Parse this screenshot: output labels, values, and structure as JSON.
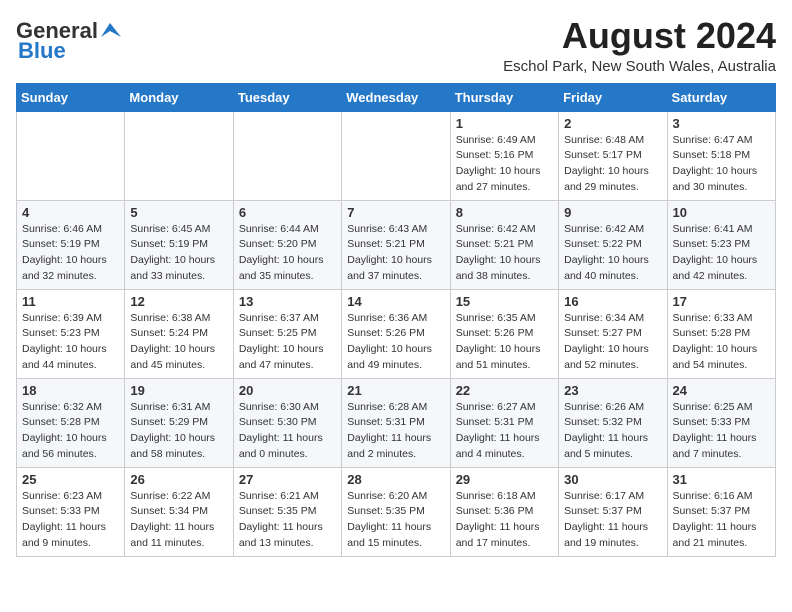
{
  "logo": {
    "general": "General",
    "blue": "Blue"
  },
  "header": {
    "month_year": "August 2024",
    "location": "Eschol Park, New South Wales, Australia"
  },
  "days_of_week": [
    "Sunday",
    "Monday",
    "Tuesday",
    "Wednesday",
    "Thursday",
    "Friday",
    "Saturday"
  ],
  "weeks": [
    [
      {
        "day": "",
        "info": ""
      },
      {
        "day": "",
        "info": ""
      },
      {
        "day": "",
        "info": ""
      },
      {
        "day": "",
        "info": ""
      },
      {
        "day": "1",
        "info": "Sunrise: 6:49 AM\nSunset: 5:16 PM\nDaylight: 10 hours\nand 27 minutes."
      },
      {
        "day": "2",
        "info": "Sunrise: 6:48 AM\nSunset: 5:17 PM\nDaylight: 10 hours\nand 29 minutes."
      },
      {
        "day": "3",
        "info": "Sunrise: 6:47 AM\nSunset: 5:18 PM\nDaylight: 10 hours\nand 30 minutes."
      }
    ],
    [
      {
        "day": "4",
        "info": "Sunrise: 6:46 AM\nSunset: 5:19 PM\nDaylight: 10 hours\nand 32 minutes."
      },
      {
        "day": "5",
        "info": "Sunrise: 6:45 AM\nSunset: 5:19 PM\nDaylight: 10 hours\nand 33 minutes."
      },
      {
        "day": "6",
        "info": "Sunrise: 6:44 AM\nSunset: 5:20 PM\nDaylight: 10 hours\nand 35 minutes."
      },
      {
        "day": "7",
        "info": "Sunrise: 6:43 AM\nSunset: 5:21 PM\nDaylight: 10 hours\nand 37 minutes."
      },
      {
        "day": "8",
        "info": "Sunrise: 6:42 AM\nSunset: 5:21 PM\nDaylight: 10 hours\nand 38 minutes."
      },
      {
        "day": "9",
        "info": "Sunrise: 6:42 AM\nSunset: 5:22 PM\nDaylight: 10 hours\nand 40 minutes."
      },
      {
        "day": "10",
        "info": "Sunrise: 6:41 AM\nSunset: 5:23 PM\nDaylight: 10 hours\nand 42 minutes."
      }
    ],
    [
      {
        "day": "11",
        "info": "Sunrise: 6:39 AM\nSunset: 5:23 PM\nDaylight: 10 hours\nand 44 minutes."
      },
      {
        "day": "12",
        "info": "Sunrise: 6:38 AM\nSunset: 5:24 PM\nDaylight: 10 hours\nand 45 minutes."
      },
      {
        "day": "13",
        "info": "Sunrise: 6:37 AM\nSunset: 5:25 PM\nDaylight: 10 hours\nand 47 minutes."
      },
      {
        "day": "14",
        "info": "Sunrise: 6:36 AM\nSunset: 5:26 PM\nDaylight: 10 hours\nand 49 minutes."
      },
      {
        "day": "15",
        "info": "Sunrise: 6:35 AM\nSunset: 5:26 PM\nDaylight: 10 hours\nand 51 minutes."
      },
      {
        "day": "16",
        "info": "Sunrise: 6:34 AM\nSunset: 5:27 PM\nDaylight: 10 hours\nand 52 minutes."
      },
      {
        "day": "17",
        "info": "Sunrise: 6:33 AM\nSunset: 5:28 PM\nDaylight: 10 hours\nand 54 minutes."
      }
    ],
    [
      {
        "day": "18",
        "info": "Sunrise: 6:32 AM\nSunset: 5:28 PM\nDaylight: 10 hours\nand 56 minutes."
      },
      {
        "day": "19",
        "info": "Sunrise: 6:31 AM\nSunset: 5:29 PM\nDaylight: 10 hours\nand 58 minutes."
      },
      {
        "day": "20",
        "info": "Sunrise: 6:30 AM\nSunset: 5:30 PM\nDaylight: 11 hours\nand 0 minutes."
      },
      {
        "day": "21",
        "info": "Sunrise: 6:28 AM\nSunset: 5:31 PM\nDaylight: 11 hours\nand 2 minutes."
      },
      {
        "day": "22",
        "info": "Sunrise: 6:27 AM\nSunset: 5:31 PM\nDaylight: 11 hours\nand 4 minutes."
      },
      {
        "day": "23",
        "info": "Sunrise: 6:26 AM\nSunset: 5:32 PM\nDaylight: 11 hours\nand 5 minutes."
      },
      {
        "day": "24",
        "info": "Sunrise: 6:25 AM\nSunset: 5:33 PM\nDaylight: 11 hours\nand 7 minutes."
      }
    ],
    [
      {
        "day": "25",
        "info": "Sunrise: 6:23 AM\nSunset: 5:33 PM\nDaylight: 11 hours\nand 9 minutes."
      },
      {
        "day": "26",
        "info": "Sunrise: 6:22 AM\nSunset: 5:34 PM\nDaylight: 11 hours\nand 11 minutes."
      },
      {
        "day": "27",
        "info": "Sunrise: 6:21 AM\nSunset: 5:35 PM\nDaylight: 11 hours\nand 13 minutes."
      },
      {
        "day": "28",
        "info": "Sunrise: 6:20 AM\nSunset: 5:35 PM\nDaylight: 11 hours\nand 15 minutes."
      },
      {
        "day": "29",
        "info": "Sunrise: 6:18 AM\nSunset: 5:36 PM\nDaylight: 11 hours\nand 17 minutes."
      },
      {
        "day": "30",
        "info": "Sunrise: 6:17 AM\nSunset: 5:37 PM\nDaylight: 11 hours\nand 19 minutes."
      },
      {
        "day": "31",
        "info": "Sunrise: 6:16 AM\nSunset: 5:37 PM\nDaylight: 11 hours\nand 21 minutes."
      }
    ]
  ]
}
